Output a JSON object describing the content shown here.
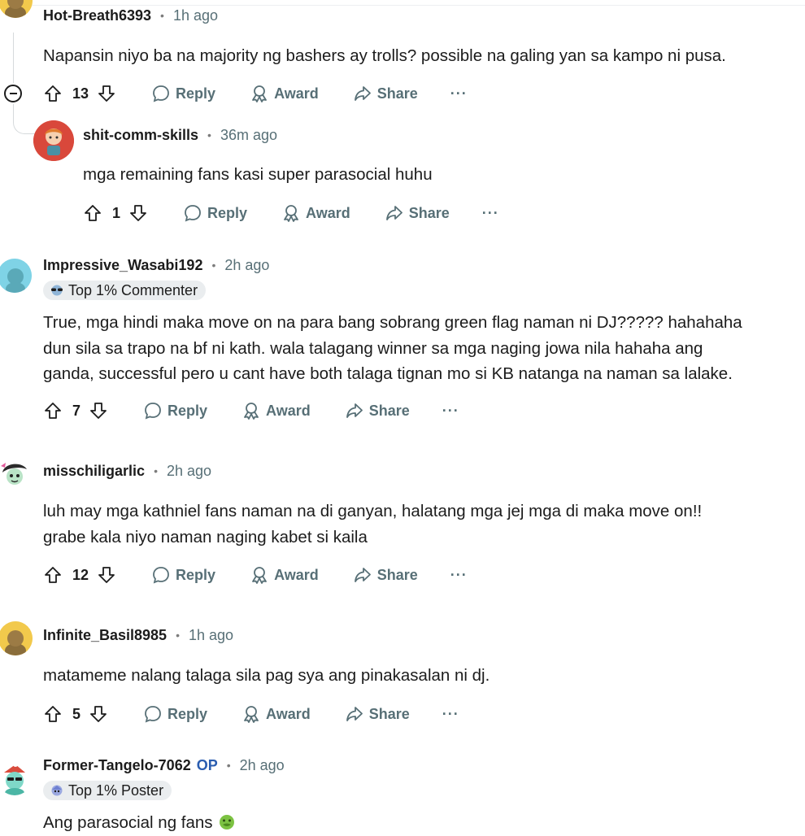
{
  "comments": [
    {
      "author": "Hot-Breath6393",
      "time": "1h ago",
      "lines": [
        "Napansin niyo ba na majority ng bashers ay trolls? possible na galing yan sa kampo ni pusa."
      ],
      "votes": "13",
      "reply": "Reply",
      "award": "Award",
      "share": "Share",
      "more": "···"
    },
    {
      "author": "shit-comm-skills",
      "time": "36m ago",
      "lines": [
        "mga remaining fans kasi super parasocial huhu"
      ],
      "votes": "1",
      "reply": "Reply",
      "award": "Award",
      "share": "Share",
      "more": "···"
    },
    {
      "author": "Impressive_Wasabi192",
      "time": "2h ago",
      "badge": "Top 1% Commenter",
      "lines": [
        "True, mga hindi maka move on na para bang sobrang green flag naman ni DJ????? hahahaha",
        "dun sila sa trapo na bf ni kath. wala talagang winner sa mga naging jowa nila hahaha ang",
        "ganda, successful pero u cant have both talaga tignan mo si KB natanga na naman sa lalake."
      ],
      "votes": "7",
      "reply": "Reply",
      "award": "Award",
      "share": "Share",
      "more": "···"
    },
    {
      "author": "misschiligarlic",
      "time": "2h ago",
      "lines": [
        "luh may mga kathniel fans naman na di ganyan, halatang mga jej mga di maka move on!!",
        "grabe kala niyo naman naging kabet si kaila"
      ],
      "votes": "12",
      "reply": "Reply",
      "award": "Award",
      "share": "Share",
      "more": "···"
    },
    {
      "author": "Infinite_Basil8985",
      "time": "1h ago",
      "lines": [
        "matameme nalang talaga sila pag sya ang pinakasalan ni dj."
      ],
      "votes": "5",
      "reply": "Reply",
      "award": "Award",
      "share": "Share",
      "more": "···"
    },
    {
      "author": "Former-Tangelo-7062",
      "op": "OP",
      "time": "2h ago",
      "badge": "Top 1% Poster",
      "lines": [
        "Ang parasocial ng fans"
      ],
      "emoji": "nauseated-face-emoji"
    }
  ],
  "colors": {
    "author": "#1c1c1c",
    "meta": "#576f76",
    "op": "#2a5db0",
    "badge_bg": "#eaedef",
    "thread_line": "#d6dadc"
  },
  "icons": [
    "upvote-icon",
    "downvote-icon",
    "reply-bubble-icon",
    "award-icon",
    "share-arrow-icon",
    "collapse-icon",
    "snoo-avatar"
  ]
}
